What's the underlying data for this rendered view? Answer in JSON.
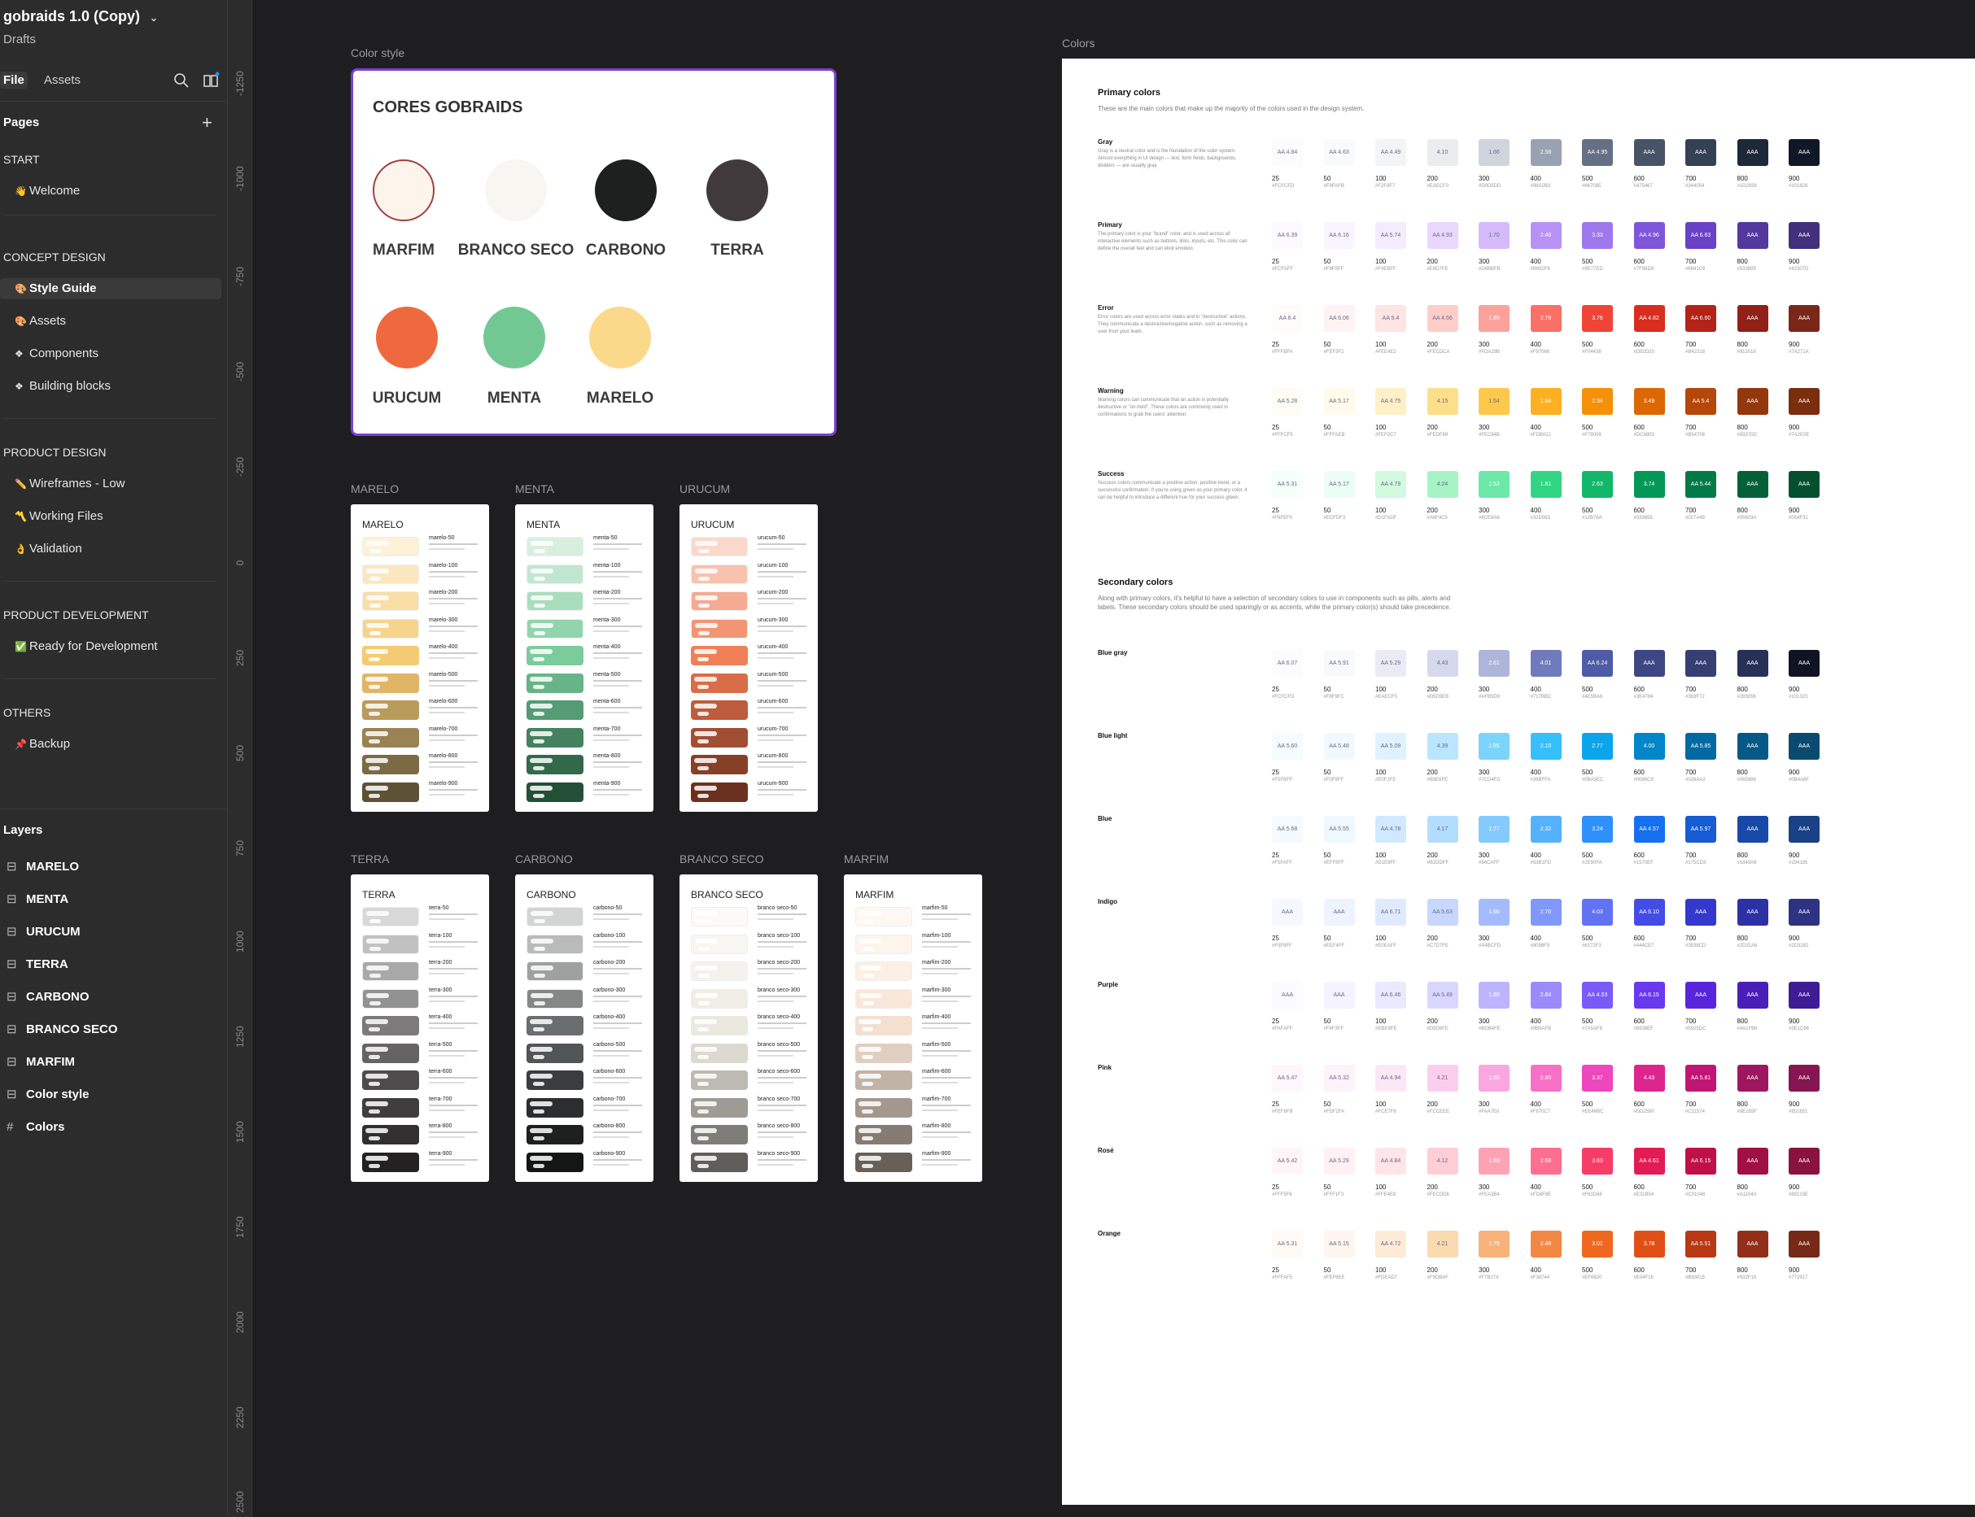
{
  "file": {
    "title": "gobraids 1.0 (Copy)",
    "subtitle": "Drafts"
  },
  "tabs": {
    "file": "File",
    "assets": "Assets"
  },
  "pages": {
    "header": "Pages",
    "sections": [
      {
        "name": "START",
        "items": [
          {
            "icon": "👋",
            "label": "Welcome"
          }
        ]
      },
      {
        "name": "CONCEPT DESIGN",
        "items": [
          {
            "icon": "🎨",
            "label": "Style Guide",
            "selected": true
          },
          {
            "icon": "🎨",
            "label": "Assets"
          },
          {
            "icon": "❖",
            "label": "Components"
          },
          {
            "icon": "❖",
            "label": "Building blocks"
          }
        ]
      },
      {
        "name": "PRODUCT DESIGN",
        "items": [
          {
            "icon": "✏️",
            "label": "Wireframes  - Low"
          },
          {
            "icon": "〽️",
            "label": "Working Files"
          },
          {
            "icon": "👌",
            "label": "Validation"
          }
        ]
      },
      {
        "name": "PRODUCT DEVELOPMENT",
        "items": [
          {
            "icon": "✅",
            "label": "Ready for Development"
          }
        ]
      },
      {
        "name": "OTHERS",
        "items": [
          {
            "icon": "📌",
            "label": "Backup"
          }
        ]
      }
    ]
  },
  "layers": {
    "header": "Layers",
    "items": [
      {
        "icon": "frame",
        "label": "MARELO"
      },
      {
        "icon": "frame",
        "label": "MENTA"
      },
      {
        "icon": "frame",
        "label": "URUCUM"
      },
      {
        "icon": "frame",
        "label": "TERRA"
      },
      {
        "icon": "frame",
        "label": "CARBONO"
      },
      {
        "icon": "frame",
        "label": "BRANCO SECO"
      },
      {
        "icon": "frame",
        "label": "MARFIM"
      },
      {
        "icon": "frame",
        "label": "Color style"
      },
      {
        "icon": "grid",
        "label": "Colors"
      }
    ]
  },
  "ruler": [
    "-1250",
    "-1000",
    "-750",
    "-500",
    "-250",
    "0",
    "250",
    "500",
    "750",
    "1000",
    "1250",
    "1500",
    "1750",
    "2000",
    "2250",
    "2500"
  ],
  "color_style": {
    "label": "Color style",
    "title": "CORES GOBRAIDS",
    "swatches": [
      {
        "name": "MARFIM",
        "color": "#fdf4ec"
      },
      {
        "name": "BRANCO SECO",
        "color": "#f8f6f1"
      },
      {
        "name": "CARBONO",
        "color": "#1e2020"
      },
      {
        "name": "TERRA",
        "color": "#403a3c"
      },
      {
        "name": "URUCUM",
        "color": "#ee6a3e"
      },
      {
        "name": "MENTA",
        "color": "#72c893"
      },
      {
        "name": "MARELO",
        "color": "#fbd98a"
      }
    ]
  },
  "palettes": [
    {
      "label": "MARELO",
      "title": "MARELO",
      "prefix": "marelo",
      "colors": [
        "#fffaf0",
        "#fdf1d8",
        "#fbe7bf",
        "#f9dea6",
        "#f6d48c",
        "#f3cb72",
        "#e0b565",
        "#b99b5c",
        "#9a8352",
        "#7b6b45",
        "#5c5236"
      ]
    },
    {
      "label": "MENTA",
      "title": "MENTA",
      "prefix": "menta",
      "colors": [
        "#eef8f1",
        "#d8efe0",
        "#c1e6cf",
        "#a9ddbe",
        "#92d4ad",
        "#7bcb9c",
        "#66b487",
        "#559b73",
        "#44825f",
        "#33694b",
        "#234f37"
      ]
    },
    {
      "label": "URUCUM",
      "title": "URUCUM",
      "prefix": "urucum",
      "colors": [
        "#fdeee8",
        "#fad8cb",
        "#f7c2ae",
        "#f4ab91",
        "#f19574",
        "#ee7f57",
        "#d86d48",
        "#bd5d3d",
        "#a24e33",
        "#874028",
        "#6c311e"
      ]
    },
    {
      "label": "TERRA",
      "title": "TERRA",
      "prefix": "terra",
      "colors": [
        "#f0efef",
        "#d9d8d8",
        "#c2c1c1",
        "#aaa9a9",
        "#939292",
        "#7c7a7b",
        "#656364",
        "#4e4c4d",
        "#403d3f",
        "#312f30",
        "#232122"
      ]
    },
    {
      "label": "CARBONO",
      "title": "CARBONO",
      "prefix": "carbono",
      "colors": [
        "#eceded",
        "#d3d4d4",
        "#b9baba",
        "#9fa1a1",
        "#858787",
        "#6b6e6e",
        "#525555",
        "#3a3d3d",
        "#2b2e2e",
        "#1e2020",
        "#141616"
      ]
    },
    {
      "label": "BRANCO SECO",
      "title": "BRANCO SECO",
      "prefix": "branco seco",
      "colors": [
        "#fdfdfc",
        "#fbfaf8",
        "#f8f6f1",
        "#f4f2ec",
        "#f0ede6",
        "#ebe8e0",
        "#dcd9d1",
        "#bdbab3",
        "#9e9b95",
        "#7f7d78",
        "#605e5a"
      ]
    },
    {
      "label": "MARFIM",
      "title": "MARFIM",
      "prefix": "marfim",
      "colors": [
        "#fffcf9",
        "#fef8f2",
        "#fdf4ec",
        "#fcefe3",
        "#f9e8da",
        "#f3e0d1",
        "#e0cfc1",
        "#c2b3a7",
        "#a4978d",
        "#867b73",
        "#685f59"
      ]
    }
  ],
  "colors_frame": {
    "label": "Colors",
    "primary_title": "Primary colors",
    "primary_desc": "These are the main colors that make up the majority of the colors used in the design system.",
    "secondary_title": "Secondary colors",
    "secondary_desc": "Along with primary colors, it's helpful to have a selection of secondary colors to use in components such as pills, alerts and labels. These secondary colors should be used sparingly or as accents, while the primary color(s) should take precedence.",
    "shades": [
      "25",
      "50",
      "100",
      "200",
      "300",
      "400",
      "500",
      "600",
      "700",
      "800",
      "900"
    ],
    "primary_groups": [
      {
        "name": "Gray",
        "desc": "Gray is a neutral color and is the foundation of the color system. Almost everything in UI design — text, form fields, backgrounds, dividers — are usually gray.",
        "colors": [
          "#FCFCFD",
          "#F9FAFB",
          "#F2F4F7",
          "#EAECF0",
          "#D0D5DD",
          "#98A2B3",
          "#667085",
          "#475467",
          "#344054",
          "#1D2939",
          "#101828"
        ],
        "labels": [
          "AA 4.84",
          "AA 4.63",
          "AA 4.49",
          "4.10",
          "1.66",
          "2.58",
          "AA 4.95",
          "AAA",
          "AAA",
          "AAA",
          "AAA"
        ]
      },
      {
        "name": "Primary",
        "desc": "The primary color is your \"brand\" color, and is used across all interactive elements such as buttons, links, inputs, etc. This color can define the overall feel and can elicit emotion.",
        "colors": [
          "#FCFAFF",
          "#F9F5FF",
          "#F4EBFF",
          "#E9D7FE",
          "#D6BBFB",
          "#B692F6",
          "#9E77ED",
          "#7F56D9",
          "#6941C6",
          "#53389E",
          "#42307D"
        ],
        "labels": [
          "AA 6.39",
          "AA 6.16",
          "AA 5.74",
          "AA 4.93",
          "1.70",
          "2.48",
          "3.33",
          "AA 4.96",
          "AA 6.63",
          "AAA",
          "AAA"
        ]
      },
      {
        "name": "Error",
        "desc": "Error colors are used across error states and in \"destructive\" actions. They communicate a destructive/negative action, such as removing a user from your team.",
        "colors": [
          "#FFFBFA",
          "#FEF3F2",
          "#FEE4E2",
          "#FECDCA",
          "#FDA29B",
          "#F97066",
          "#F04438",
          "#D92D20",
          "#B42318",
          "#912018",
          "#7A271A"
        ],
        "labels": [
          "AA 6.4",
          "AA 6.06",
          "AA 5.4",
          "AA 4.56",
          "1.85",
          "2.76",
          "3.76",
          "AA 4.82",
          "AA 6.60",
          "AAA",
          "AAA"
        ]
      },
      {
        "name": "Warning",
        "desc": "Warning colors can communicate that an action is potentially destructive or \"on-hold\". These colors are commonly used in confirmations to grab the users' attention.",
        "colors": [
          "#FFFCF5",
          "#FFFAEB",
          "#FEF0C7",
          "#FEDF89",
          "#FEC84B",
          "#FDB022",
          "#F79009",
          "#DC6803",
          "#B54708",
          "#93370D",
          "#7A2E0E"
        ],
        "labels": [
          "AA 5.28",
          "AA 5.17",
          "AA 4.75",
          "4.15",
          "1.54",
          "1.84",
          "2.34",
          "3.49",
          "AA 5.4",
          "AAA",
          "AAA"
        ]
      },
      {
        "name": "Success",
        "desc": "Success colors communicate a positive action, positive trend, or a successful confirmation. If you're using green as your primary color, it can be helpful to introduce a different hue for your success green.",
        "colors": [
          "#F6FEF9",
          "#ECFDF3",
          "#D1FADF",
          "#A6F4C5",
          "#6CE9A6",
          "#32D583",
          "#12B76A",
          "#039855",
          "#027A48",
          "#05603A",
          "#054F31"
        ],
        "labels": [
          "AA 5.31",
          "AA 5.17",
          "AA 4.79",
          "4.24",
          "1.53",
          "1.81",
          "2.63",
          "3.74",
          "AA 5.44",
          "AAA",
          "AAA"
        ]
      }
    ],
    "secondary_groups": [
      {
        "name": "Blue gray",
        "colors": [
          "#FCFCFD",
          "#F8F9FC",
          "#EAECF5",
          "#D5D9EB",
          "#AFB5D9",
          "#717BBC",
          "#4E5BA6",
          "#3E4784",
          "#363F72",
          "#293056",
          "#101323"
        ],
        "labels": [
          "AA 6.07",
          "AA 5.91",
          "AA 5.29",
          "4.43",
          "2.61",
          "4.01",
          "AA 6.24",
          "AAA",
          "AAA",
          "AAA",
          "AAA"
        ]
      },
      {
        "name": "Blue light",
        "colors": [
          "#F5FBFF",
          "#F0F9FF",
          "#E0F2FE",
          "#B9E6FE",
          "#7CD4FD",
          "#36BFFA",
          "#0BA5EC",
          "#0086C9",
          "#026AA2",
          "#065986",
          "#0B4A6F"
        ],
        "labels": [
          "AA 5.60",
          "AA 5.48",
          "AA 5.09",
          "4.39",
          "1.85",
          "2.10",
          "2.77",
          "4.00",
          "AA 5.85",
          "AAA",
          "AAA"
        ]
      },
      {
        "name": "Blue",
        "colors": [
          "#F5FAFF",
          "#EFF8FF",
          "#D1E9FF",
          "#B2DDFF",
          "#84CAFF",
          "#53B1FD",
          "#2E90FA",
          "#1570EF",
          "#175CD3",
          "#1849A9",
          "#194185"
        ],
        "labels": [
          "AA 5.68",
          "AA 5.55",
          "AA 4.78",
          "4.17",
          "1.77",
          "2.32",
          "3.24",
          "AA 4.57",
          "AA 5.97",
          "AAA",
          "AAA"
        ]
      },
      {
        "name": "Indigo",
        "colors": [
          "#F5F8FF",
          "#EEF4FF",
          "#E0EAFF",
          "#C7D7FE",
          "#A4BCFD",
          "#8098F9",
          "#6172F3",
          "#444CE7",
          "#3538CD",
          "#2D31A6",
          "#2D3282"
        ],
        "labels": [
          "AAA",
          "AAA",
          "AA 6.71",
          "AA 5.63",
          "1.66",
          "2.70",
          "4.03",
          "AA 6.10",
          "AAA",
          "AAA",
          "AAA"
        ]
      },
      {
        "name": "Purple",
        "colors": [
          "#FAFAFF",
          "#F4F3FF",
          "#EBE9FE",
          "#D9D6FE",
          "#BDB4FE",
          "#9B8AFB",
          "#7A5AF8",
          "#6938EF",
          "#5925DC",
          "#4A1FB8",
          "#3E1C96"
        ],
        "labels": [
          "AAA",
          "AAA",
          "AA 6.46",
          "AA 5.49",
          "1.89",
          "2.84",
          "AA 4.53",
          "AA 6.15",
          "AAA",
          "AAA",
          "AAA"
        ]
      },
      {
        "name": "Pink",
        "colors": [
          "#FEF6FB",
          "#FDF2FA",
          "#FCE7F6",
          "#FCCEEE",
          "#FAA7E0",
          "#F670C7",
          "#EE46BC",
          "#DD2590",
          "#C11574",
          "#9E165F",
          "#851651"
        ],
        "labels": [
          "AA 5.47",
          "AA 5.32",
          "AA 4.94",
          "4.21",
          "1.86",
          "2.80",
          "3.37",
          "4.43",
          "AA 5.81",
          "AAA",
          "AAA"
        ]
      },
      {
        "name": "Rosé",
        "colors": [
          "#FFF5F6",
          "#FFF1F3",
          "#FFE4E8",
          "#FECDD6",
          "#FEA3B4",
          "#FD6F8E",
          "#F63D68",
          "#E31B54",
          "#C01048",
          "#A11043",
          "#89123E"
        ],
        "labels": [
          "AA 5.42",
          "AA 5.29",
          "AA 4.84",
          "4.12",
          "1.89",
          "2.68",
          "3.63",
          "AA 4.61",
          "AA 6.15",
          "AAA",
          "AAA"
        ]
      },
      {
        "name": "Orange",
        "colors": [
          "#FFFAF5",
          "#FEF6EE",
          "#FDEAD7",
          "#F9DBAF",
          "#F7B27A",
          "#F38744",
          "#EF6820",
          "#E04F16",
          "#B93815",
          "#932F19",
          "#772917"
        ],
        "labels": [
          "AA 5.31",
          "AA 5.15",
          "AA 4.72",
          "4.21",
          "1.79",
          "2.49",
          "3.01",
          "3.78",
          "AA 5.51",
          "AAA",
          "AAA"
        ]
      }
    ]
  }
}
